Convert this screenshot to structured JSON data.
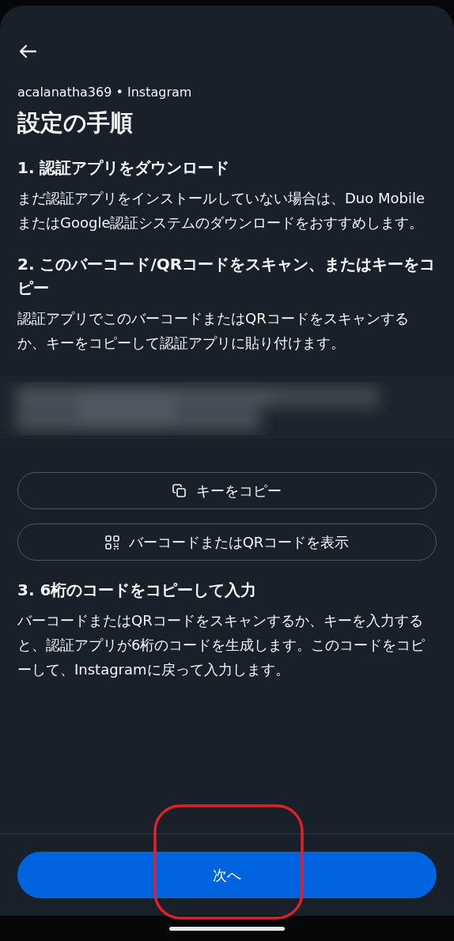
{
  "account_line": "acalanatha369 • Instagram",
  "title": "設定の手順",
  "steps": [
    {
      "heading": "1. 認証アプリをダウンロード",
      "body": "まだ認証アプリをインストールしていない場合は、Duo MobileまたはGoogle認証システムのダウンロードをおすすめします。"
    },
    {
      "heading": "2. このバーコード/QRコードをスキャン、またはキーをコピー",
      "body": "認証アプリでこのバーコードまたはQRコードをスキャンするか、キーをコピーして認証アプリに貼り付けます。",
      "key": {
        "kind": "picture"
      },
      "buttons": [
        {
          "kind": "copy",
          "label": "キーをコピー"
        },
        {
          "kind": "qr",
          "label": "バーコードまたはQRコードを表示"
        }
      ]
    },
    {
      "heading": "3. 6桁のコードをコピーして入力",
      "body": "バーコードまたはQRコードをスキャンするか、キーを入力すると、認証アプリが6桁のコードを生成します。このコードをコピーして、Instagramに戻って入力します。"
    }
  ],
  "next_button": "次へ"
}
